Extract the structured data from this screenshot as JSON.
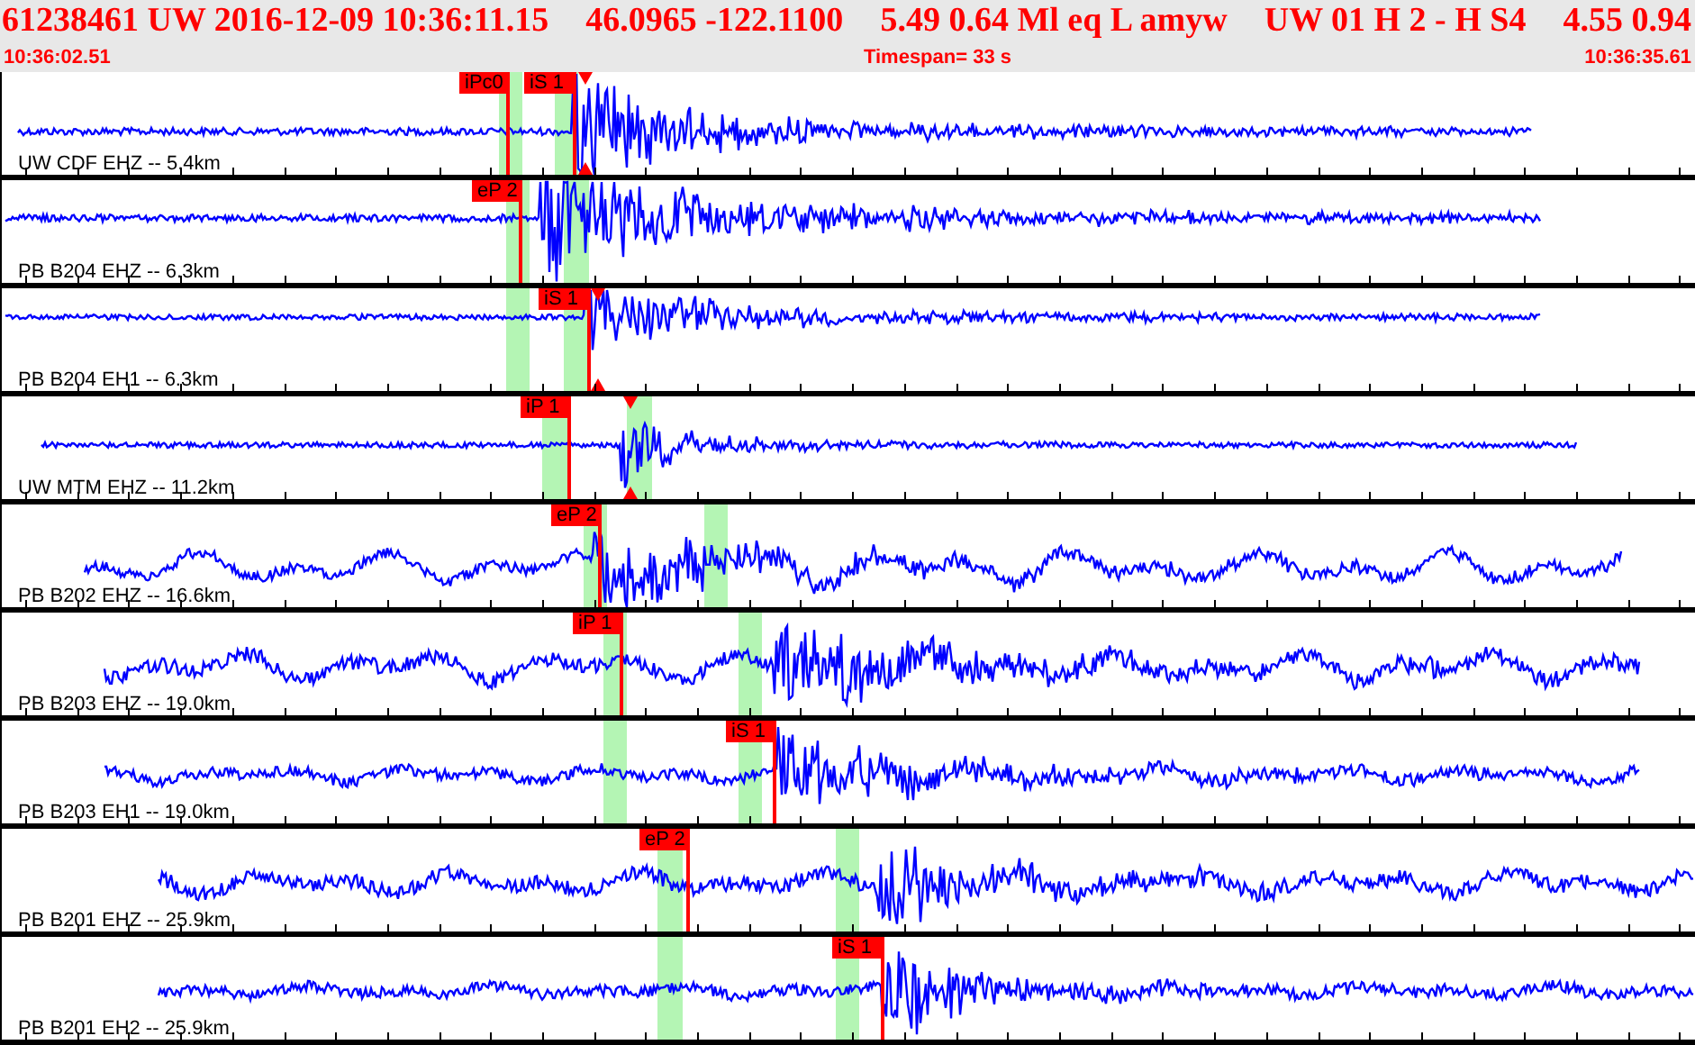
{
  "header": {
    "items": [
      "61238461 UW 2016-12-09 10:36:11.15",
      "46.0965 -122.1100",
      "5.49 0.64 Ml eq L amyw",
      "UW 01 H 2 - H S4",
      "4.55 0.94"
    ],
    "start_time": "10:36:02.51",
    "timespan": "Timespan= 33 s",
    "end_time": "10:36:35.61"
  },
  "traces": [
    {
      "label": "UW CDF EHZ -- 5.4km",
      "picks": [
        {
          "label": "iPc0"
        },
        {
          "label": "iS 1"
        }
      ]
    },
    {
      "label": "PB B204 EHZ -- 6.3km",
      "picks": [
        {
          "label": "eP 2"
        }
      ]
    },
    {
      "label": "PB B204 EH1 -- 6.3km",
      "picks": [
        {
          "label": "iS 1"
        }
      ]
    },
    {
      "label": "UW MTM EHZ -- 11.2km",
      "picks": [
        {
          "label": "iP 1"
        }
      ]
    },
    {
      "label": "PB B202 EHZ -- 16.6km",
      "picks": [
        {
          "label": "eP 2"
        }
      ]
    },
    {
      "label": "PB B203 EHZ -- 19.0km",
      "picks": [
        {
          "label": "iP 1"
        }
      ]
    },
    {
      "label": "PB B203 EH1 -- 19.0km",
      "picks": [
        {
          "label": "iS 1"
        }
      ]
    },
    {
      "label": "PB B201 EHZ -- 25.9km",
      "picks": [
        {
          "label": "eP 2"
        }
      ]
    },
    {
      "label": "PB B201 EH2 -- 25.9km",
      "picks": [
        {
          "label": "iS 1"
        }
      ]
    }
  ]
}
